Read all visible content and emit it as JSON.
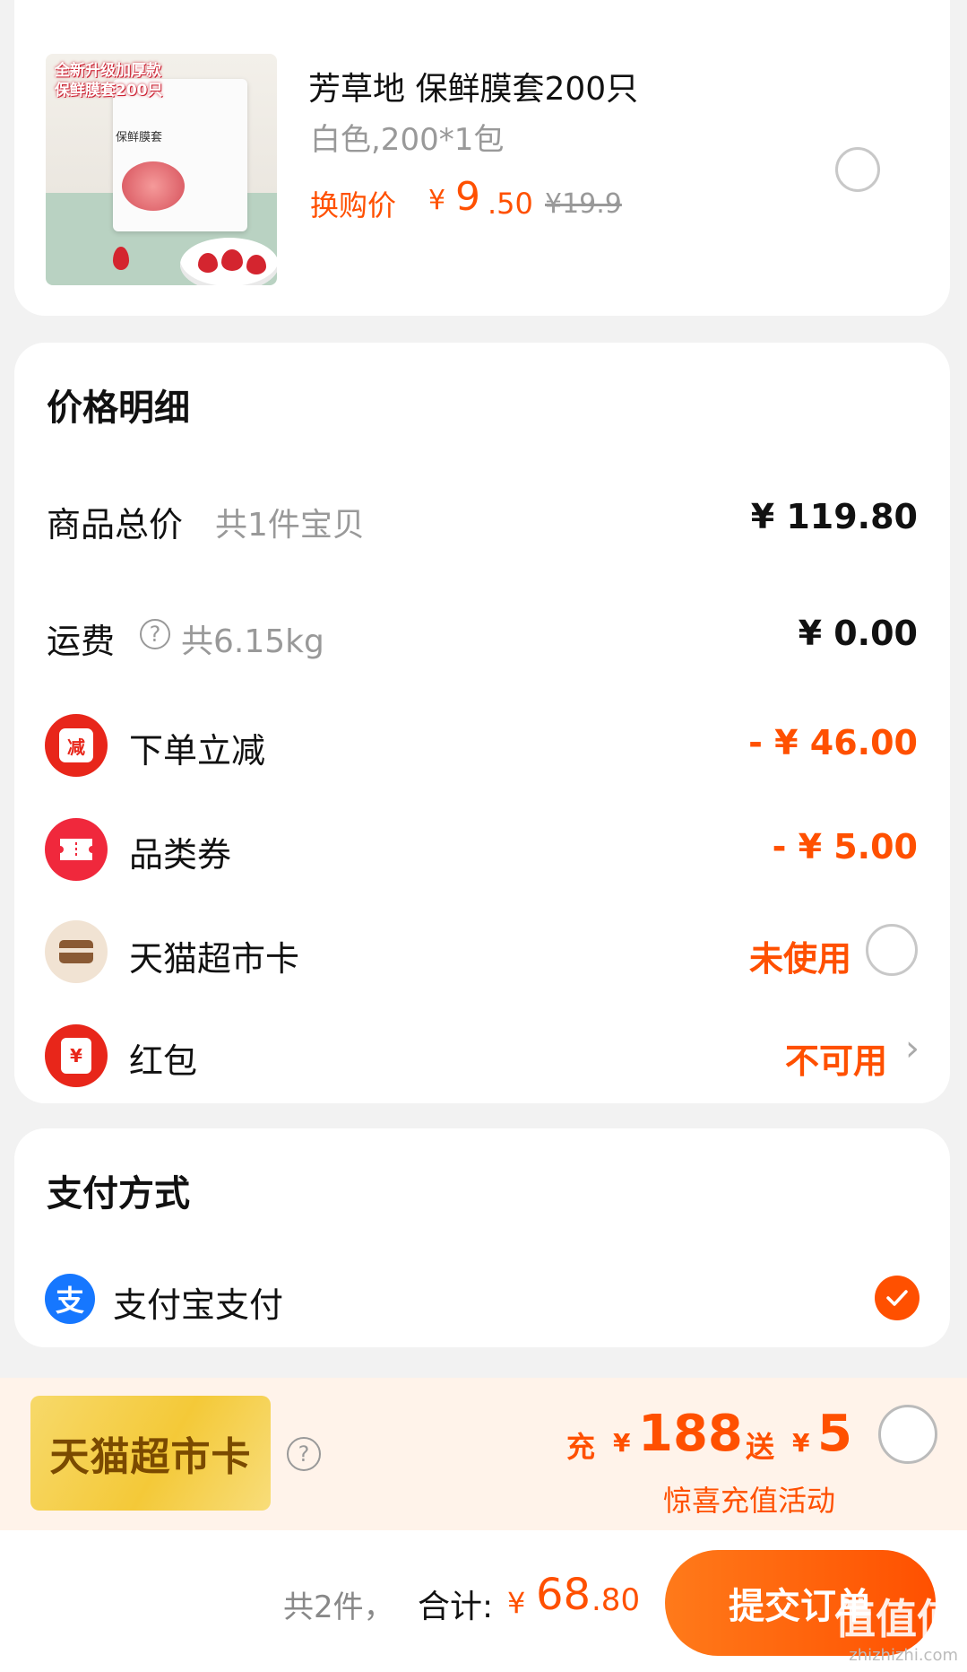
{
  "product": {
    "image_tag_line1": "全新升级加厚款",
    "image_tag_line2": "保鲜膜套200只",
    "image_bag_title": "保鲜膜套",
    "title": "芳草地 保鲜膜套200只",
    "spec": "白色,200*1包",
    "price_label": "换购价",
    "yen": "¥",
    "price_int": "9",
    "price_dec": ".50",
    "original_price": "¥19.9",
    "selected": false
  },
  "price_detail": {
    "title": "价格明细",
    "goods_total_label": "商品总价",
    "goods_total_sub": "共1件宝贝",
    "goods_total_value": "¥ 119.80",
    "shipping_label": "运费",
    "shipping_help": "?",
    "shipping_sub": "共6.15kg",
    "shipping_value": "¥ 0.00",
    "instant_discount_badge": "减",
    "instant_discount_label": "下单立减",
    "instant_discount_value": "- ¥ 46.00",
    "category_coupon_label": "品类券",
    "category_coupon_value": "- ¥ 5.00",
    "tmall_card_label": "天猫超市卡",
    "tmall_card_status": "未使用",
    "red_packet_badge": "¥",
    "red_packet_label": "红包",
    "red_packet_status": "不可用",
    "chevron": "›"
  },
  "payment": {
    "title": "支付方式",
    "alipay_icon_char": "支",
    "alipay_label": "支付宝支付",
    "selected": true
  },
  "recharge": {
    "card_label": "天猫超市卡",
    "help": "?",
    "charge_label": "充",
    "yen": "¥",
    "charge_amount": "188",
    "gift_label": "送",
    "gift_amount": "5",
    "subtitle": "惊喜充值活动",
    "selected": false
  },
  "footer": {
    "count": "共2件，",
    "total_label": "合计:",
    "yen": "¥",
    "total_int": "68",
    "total_dec": ".80",
    "submit_label": "提交订单",
    "watermark": "值值值",
    "watermark_url": "zhizhizhi.com"
  },
  "colors": {
    "accent": "#ff5000",
    "discount_badge": "#e8261a",
    "coupon_badge": "#f0283c",
    "card_badge": "#f1e3d3",
    "alipay": "#1677ff"
  }
}
